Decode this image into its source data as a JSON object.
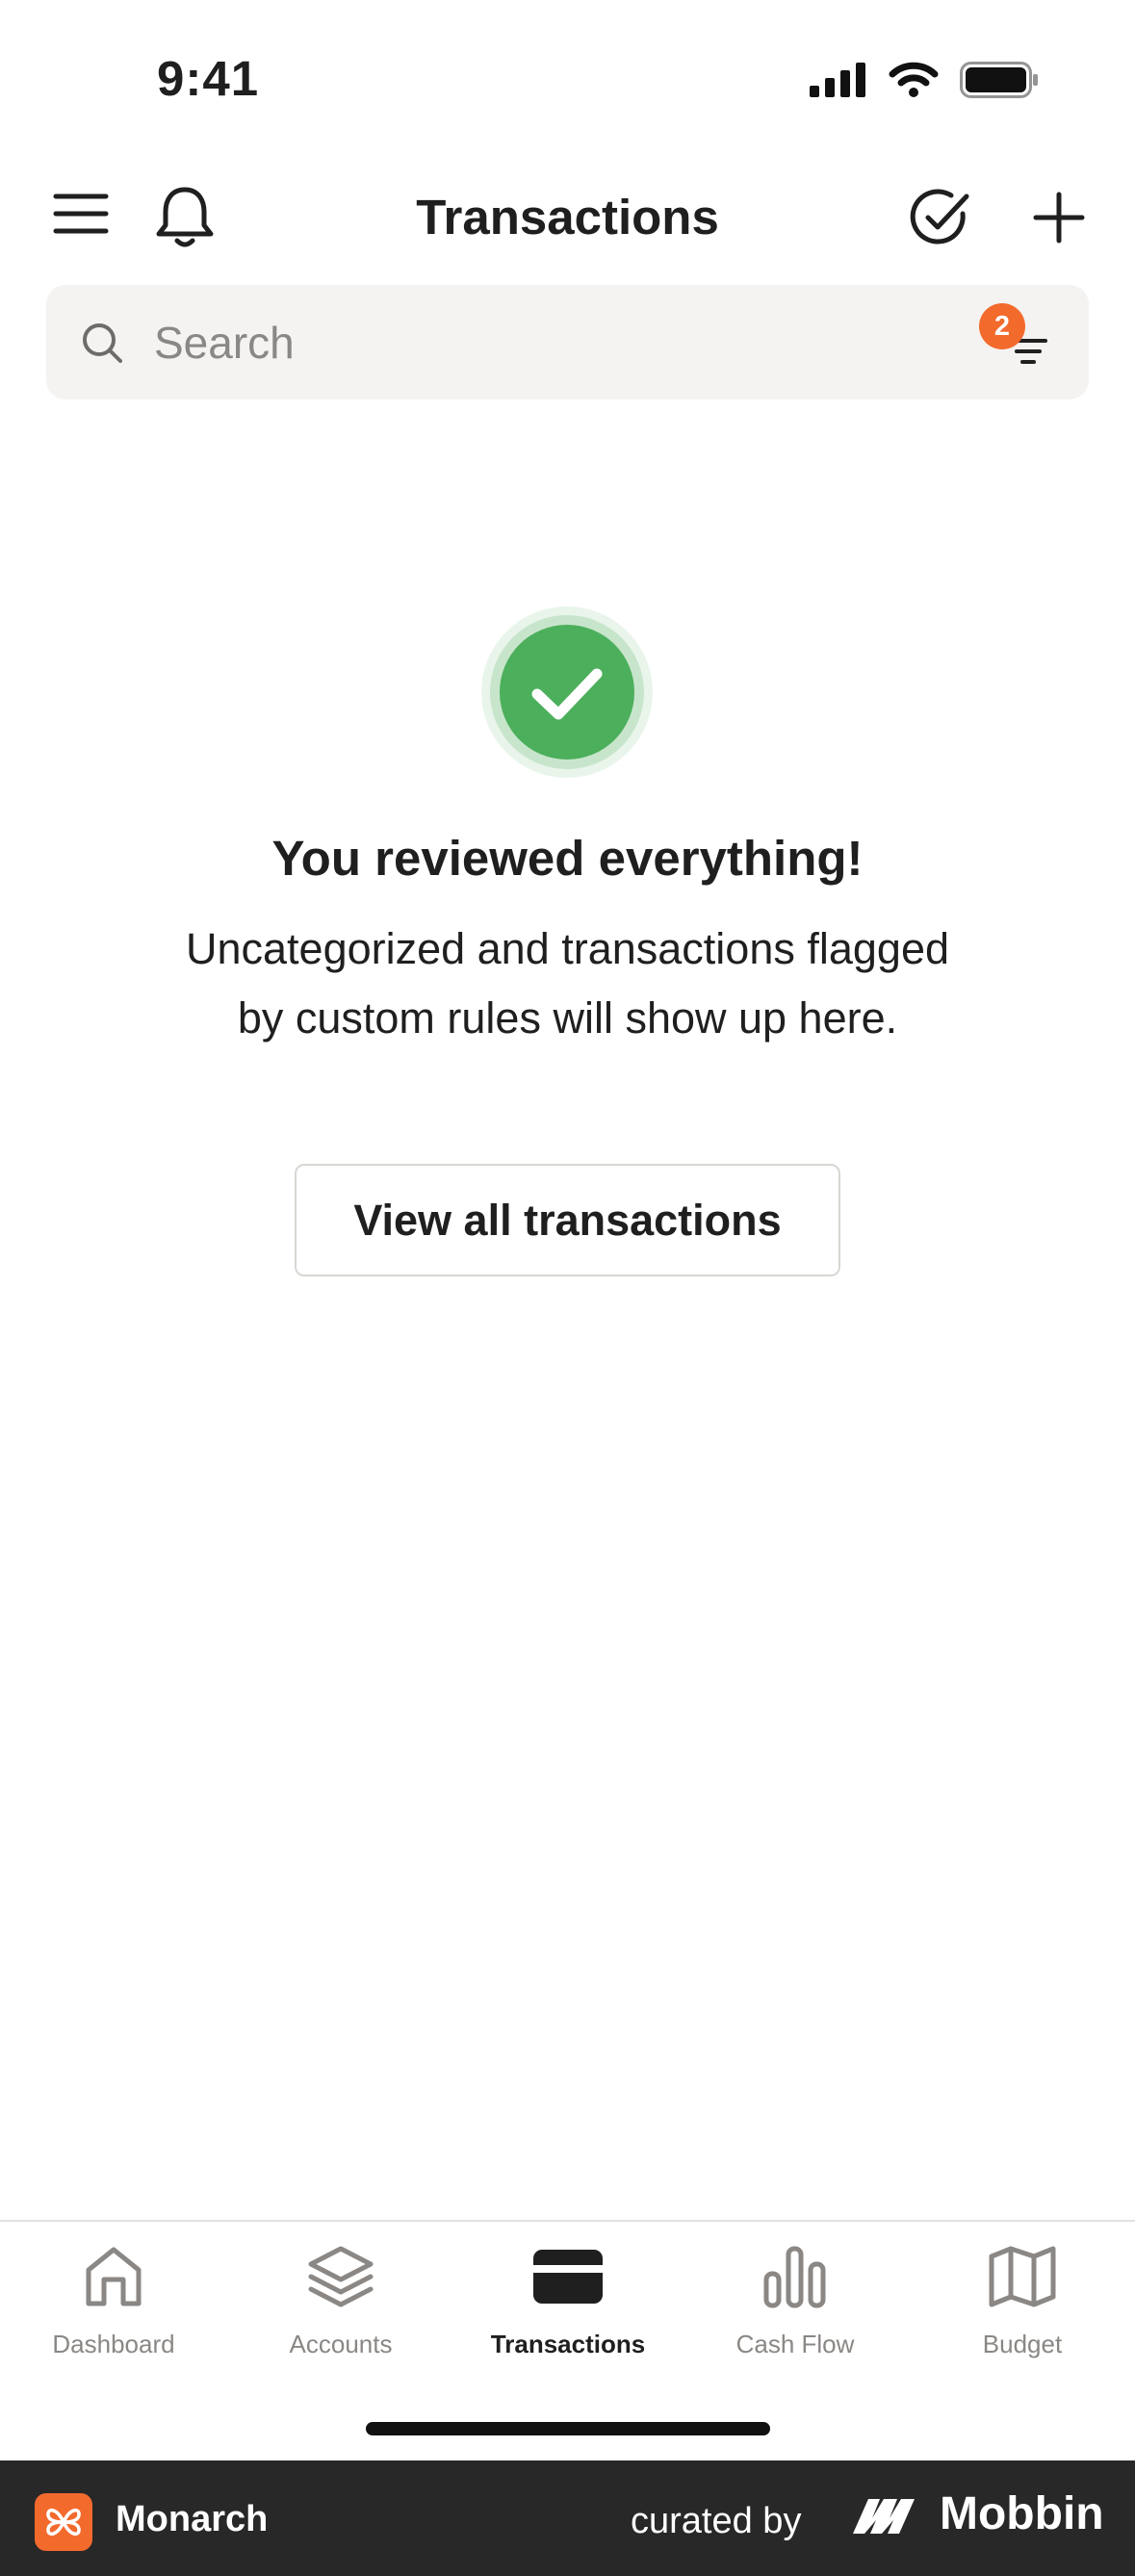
{
  "status_bar": {
    "time": "9:41"
  },
  "header": {
    "title": "Transactions"
  },
  "search": {
    "placeholder": "Search",
    "filter_count": "2"
  },
  "empty_state": {
    "heading": "You reviewed everything!",
    "description": "Uncategorized and transactions flagged by custom rules will show up here.",
    "button_label": "View all transactions"
  },
  "tabbar": {
    "items": [
      {
        "label": "Dashboard",
        "icon": "home-icon",
        "active": false
      },
      {
        "label": "Accounts",
        "icon": "layers-icon",
        "active": false
      },
      {
        "label": "Transactions",
        "icon": "card-icon",
        "active": true
      },
      {
        "label": "Cash Flow",
        "icon": "bar-chart-icon",
        "active": false
      },
      {
        "label": "Budget",
        "icon": "map-icon",
        "active": false
      }
    ]
  },
  "footer": {
    "brand": "Monarch",
    "curated_by": "curated by",
    "curator": "Mobbin"
  },
  "colors": {
    "accent": "#f36a2d",
    "success": "#4caf5c",
    "text": "#1f1f1f",
    "muted": "#8a8784"
  }
}
